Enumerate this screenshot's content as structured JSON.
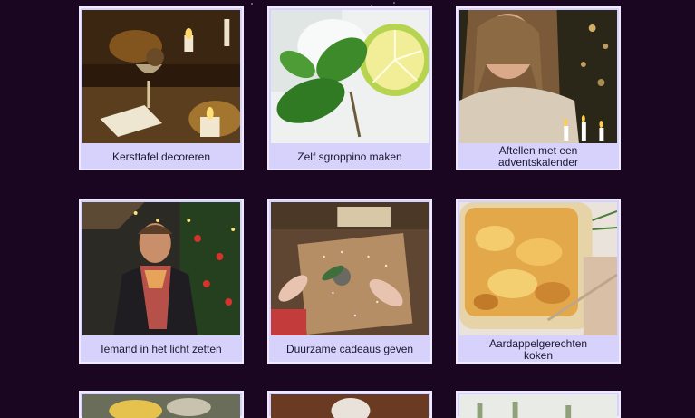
{
  "cards": [
    {
      "label": "Kersttafel decoreren",
      "image": "candlelit-christmas-table"
    },
    {
      "label": "Zelf sgroppino maken",
      "image": "sgroppino-mint-lime"
    },
    {
      "label": "Aftellen met een adventskalender",
      "image": "woman-lighting-candles"
    },
    {
      "label": "Iemand in het licht zetten",
      "image": "man-christmas-market"
    },
    {
      "label": "Duurzame cadeaus geven",
      "image": "wrapping-kraft-gift"
    },
    {
      "label": "Aardappelgerechten koken",
      "image": "potato-gratin-dish"
    },
    {
      "label": "",
      "image": "partial-card-1"
    },
    {
      "label": "",
      "image": "partial-card-2"
    },
    {
      "label": "",
      "image": "partial-card-3"
    }
  ]
}
